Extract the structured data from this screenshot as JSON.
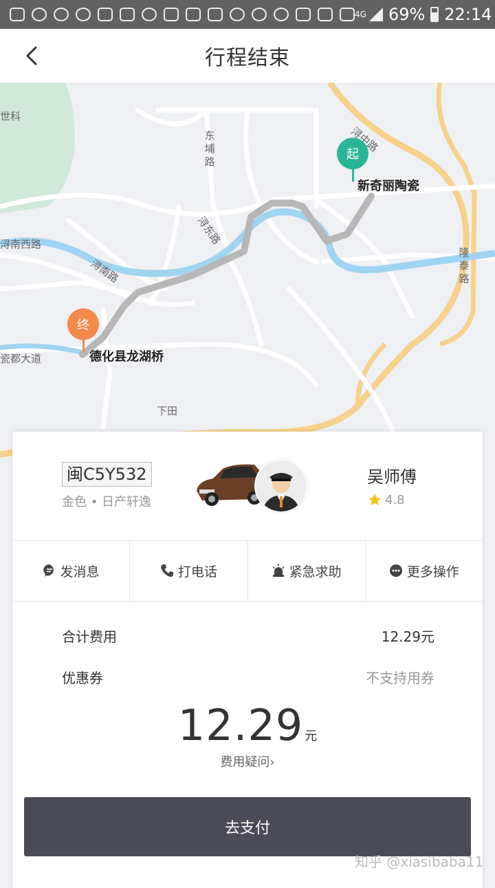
{
  "status_bar": {
    "signal_label": "4G",
    "battery": "69%",
    "battery_level": 0.69,
    "time": "22:14",
    "icons": [
      "chat-icon",
      "weibo-icon",
      "weibo-icon",
      "weibo-icon",
      "app-icon",
      "sogou-icon",
      "search-icon",
      "alipay-icon",
      "image-icon",
      "didi-icon",
      "wechat-icon",
      "wechat-icon",
      "location-icon",
      "bluetooth-icon",
      "nfc-icon",
      "mute-icon"
    ]
  },
  "header": {
    "title": "行程结束"
  },
  "map": {
    "start_pin": "起",
    "end_pin": "终",
    "start_name": "新奇丽陶瓷",
    "end_name": "德化县龙湖桥",
    "start_color": "#2bb598",
    "end_color": "#f5894a",
    "road_labels": {
      "shike": "世科",
      "dongpu": "东埔路",
      "xunzhong": "浔中路",
      "xundong": "浔东路",
      "xunnanxi": "浔南西路",
      "xunnan": "浔南路",
      "longtai": "隆泰路",
      "ciduda": "瓷都大道",
      "xiatian": "下田"
    }
  },
  "driver": {
    "plate": "闽C5Y532",
    "car_desc": "金色 • 日产轩逸",
    "name": "吴师傅",
    "rating": "4.8"
  },
  "actions": [
    {
      "label": "发消息",
      "icon": "message-icon"
    },
    {
      "label": "打电话",
      "icon": "phone-icon"
    },
    {
      "label": "紧急求助",
      "icon": "alarm-icon"
    },
    {
      "label": "更多操作",
      "icon": "more-icon"
    }
  ],
  "fees": {
    "total_label": "合计费用",
    "total_value": "12.29元",
    "coupon_label": "优惠券",
    "coupon_value": "不支持用券",
    "amount": "12.29",
    "amount_unit": "元",
    "doubt_link": "费用疑问"
  },
  "pay_button": "去支付",
  "watermark": "知乎 @xiasibaba11",
  "colors": {
    "pay_button": "#4a4b56",
    "star": "#f5c518",
    "route": "#b7b7b7",
    "river": "#9fd4f2",
    "highway": "#f7d08a"
  }
}
